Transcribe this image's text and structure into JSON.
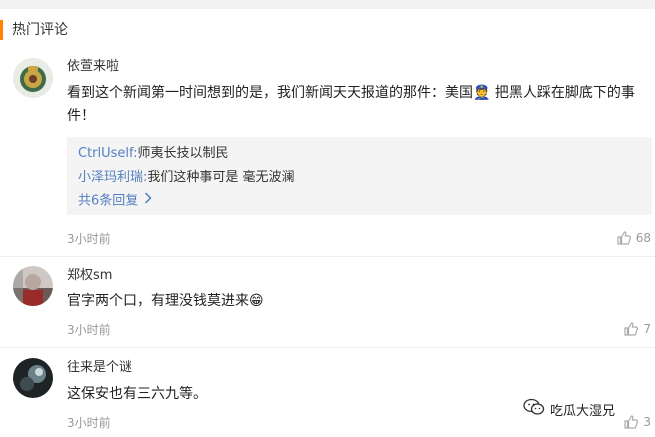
{
  "section": {
    "title": "热门评论"
  },
  "comments": [
    {
      "user": "依萱来啦",
      "content": "看到这个新闻第一时间想到的是，我们新闻天天报道的那件：美国👮 把黑人踩在脚底下的事件！",
      "replies": [
        {
          "user": "CtrlUself:",
          "text": "师夷长技以制民"
        },
        {
          "user": "小泽玛利瑞:",
          "text": "我们这种事可是 毫无波澜"
        }
      ],
      "more_replies": "共6条回复",
      "time": "3小时前",
      "likes": "68"
    },
    {
      "user": "郑权sm",
      "content": "官字两个口，有理没钱莫进来😁",
      "time": "3小时前",
      "likes": "7"
    },
    {
      "user": "往来是个谜",
      "content": "这保安也有三六九等。",
      "time": "3小时前",
      "likes": "3"
    }
  ],
  "watermark": {
    "text": "吃瓜大湿兄"
  },
  "icons": {
    "like": "thumbs-up-icon",
    "chevron": "chevron-right-icon",
    "watermark": "wechat-icon"
  },
  "colors": {
    "accent": "#ff8200",
    "link": "#527fc1",
    "muted": "#999999"
  }
}
